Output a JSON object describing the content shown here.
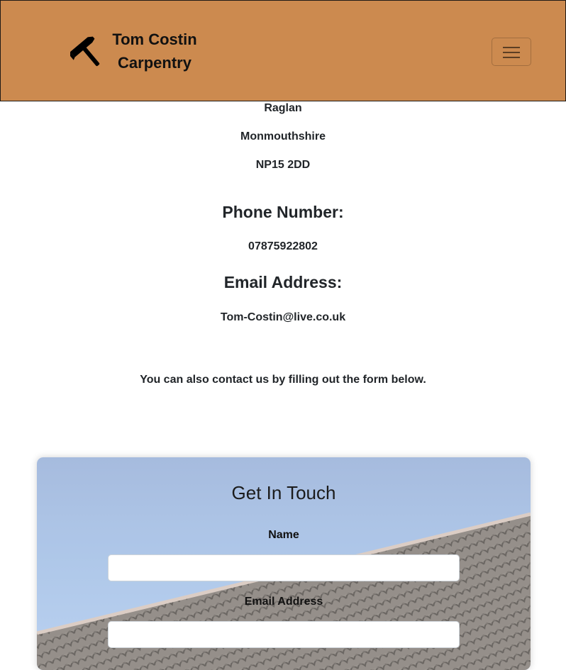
{
  "navbar": {
    "brand_line1": "Tom Costin",
    "brand_line2": "Carpentry",
    "brand_icon": "hammer-icon",
    "menu_icon": "hamburger-menu-icon",
    "background_color": "#cc8a4f"
  },
  "address": {
    "line_town": "Raglan",
    "line_county": "Monmouthshire",
    "line_postcode": "NP15 2DD"
  },
  "phone": {
    "heading": "Phone Number:",
    "value": "07875922802"
  },
  "email": {
    "heading": "Email Address:",
    "value": "Tom-Costin@live.co.uk"
  },
  "form_intro": "You can also contact us by filling out the form below.",
  "contact_form": {
    "title": "Get In Touch",
    "name_label": "Name",
    "name_value": "",
    "email_label": "Email Address",
    "email_value": ""
  }
}
